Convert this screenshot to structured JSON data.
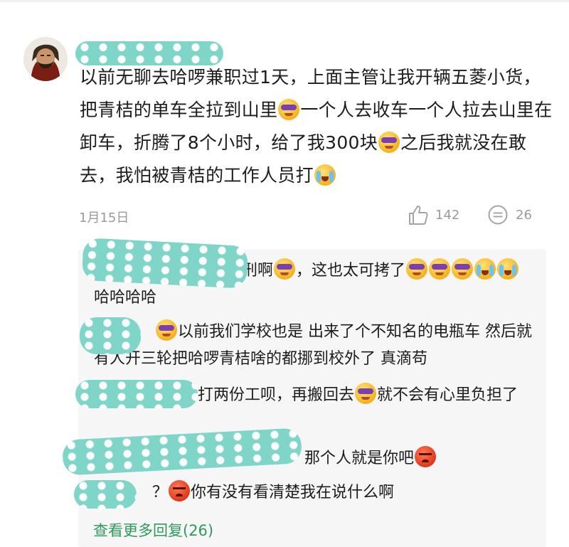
{
  "comment": {
    "username": "",
    "text_parts": {
      "p1": "以前无聊去哈啰兼职过1天，上面主管让我开辆五菱小货，把青桔的单车全拉到山里",
      "p2": "一个人去收车一个人拉去山里在卸车，折腾了8个小时，给了我300块",
      "p3": "之后我就没在敢去，我怕被青桔的工作人员打"
    },
    "date": "1月15日",
    "like_count": "142",
    "reply_count": "26"
  },
  "replies": [
    {
      "text": "刑啊",
      "text2": "，这也太可拷了",
      "text3": "哈哈哈哈"
    },
    {
      "text": "以前我们学校也是 出来了个不知名的电瓶车 然后就有人开三轮把哈啰青桔啥的都挪到校外了 真滴苟"
    },
    {
      "text": "打两份工呗，再搬回去",
      "text2": "就不会有心里负担了"
    },
    {
      "text": "那个人就是你吧"
    },
    {
      "text": "？",
      "text2": "你有没有看清楚我在说什么啊"
    }
  ],
  "more_replies_label": "查看更多回复(26)",
  "colors": {
    "accent_green": "#2e9a5c",
    "mask_teal": "#7fd6c8",
    "meta_gray": "#9a9a9a"
  },
  "icons": [
    "like-icon",
    "reply-icon",
    "avatar"
  ]
}
